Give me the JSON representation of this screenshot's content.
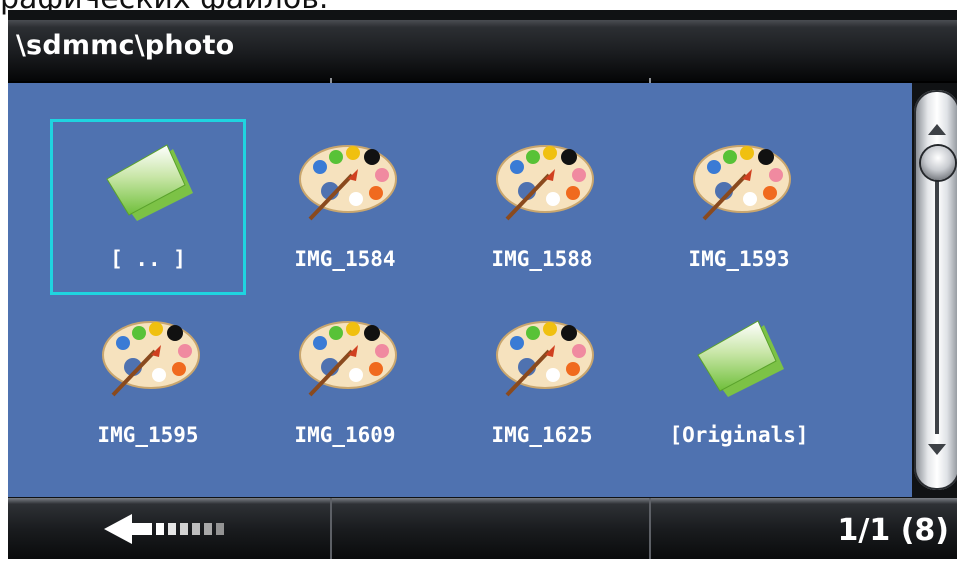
{
  "window": {
    "caption_fragment": "рафических файлов."
  },
  "header": {
    "path": "\\sdmmc\\photo"
  },
  "files": [
    {
      "label": "[ .. ]",
      "icon": "folder-icon",
      "selected": true
    },
    {
      "label": "IMG_1584",
      "icon": "palette-icon"
    },
    {
      "label": "IMG_1588",
      "icon": "palette-icon"
    },
    {
      "label": "IMG_1593",
      "icon": "palette-icon"
    },
    {
      "label": "IMG_1595",
      "icon": "palette-icon"
    },
    {
      "label": "IMG_1609",
      "icon": "palette-icon"
    },
    {
      "label": "IMG_1625",
      "icon": "palette-icon"
    },
    {
      "label": "[Originals]",
      "icon": "folder-icon"
    }
  ],
  "footer": {
    "back_icon": "back-arrow-icon",
    "page_counter": "1/1 (8)"
  },
  "colors": {
    "content_background": "#4f72b0",
    "selection_outline": "#1fd4e0"
  }
}
